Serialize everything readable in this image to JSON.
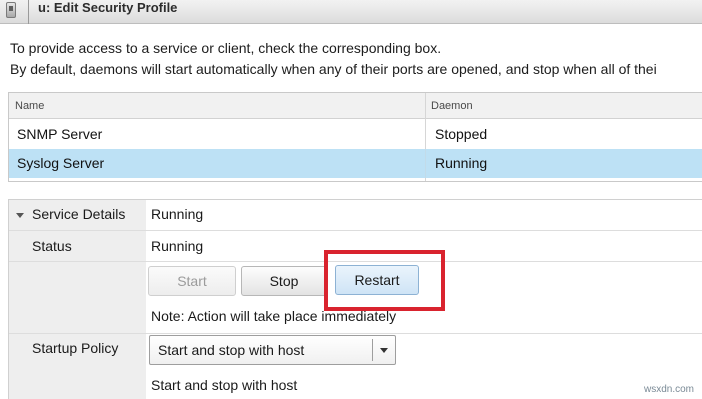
{
  "window": {
    "title": "u: Edit Security Profile"
  },
  "intro": {
    "line1": "To provide access to a service or client, check the corresponding box.",
    "line2": "By default, daemons will start automatically when any of their ports are opened, and stop when all of thei"
  },
  "services_table": {
    "columns": [
      "Name",
      "Daemon"
    ],
    "rows": [
      {
        "name": "SNMP Server",
        "daemon": "Stopped",
        "selected": false
      },
      {
        "name": "Syslog Server",
        "daemon": "Running",
        "selected": true
      }
    ]
  },
  "details": {
    "service_details_label": "Service Details",
    "service_details_value": "Running",
    "status_label": "Status",
    "status_value": "Running",
    "buttons": {
      "start": "Start",
      "stop": "Stop",
      "restart": "Restart"
    },
    "note": "Note: Action will take place immediately",
    "startup_policy_label": "Startup Policy",
    "startup_policy_selected": "Start and stop with host",
    "startup_policy_description": "Start and stop with host"
  },
  "highlight_color": "#d9232e",
  "selection_color": "#bde1f5",
  "watermark": "wsxdn.com"
}
